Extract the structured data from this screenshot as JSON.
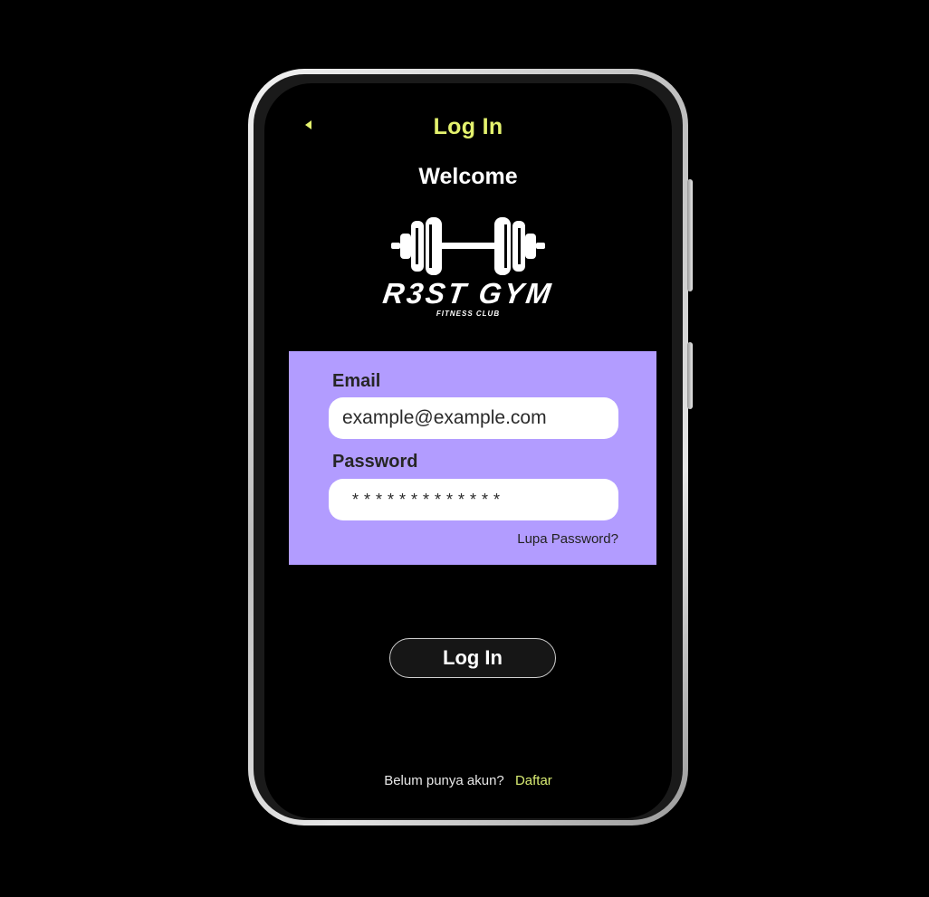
{
  "header": {
    "title": "Log In",
    "back_icon": "back-arrow-icon"
  },
  "welcome_text": "Welcome",
  "logo": {
    "brand": "R3ST GYM",
    "tagline": "FITNESS CLUB",
    "icon": "barbell-icon"
  },
  "form": {
    "email_label": "Email",
    "email_placeholder": "example@example.com",
    "password_label": "Password",
    "password_value": "*************",
    "forgot_link": "Lupa Password?"
  },
  "login_button": "Log In",
  "footer": {
    "question": "Belum punya akun?",
    "register_link": "Daftar"
  },
  "colors": {
    "accent": "#e4f26e",
    "card": "#b29cff",
    "background": "#000000"
  }
}
